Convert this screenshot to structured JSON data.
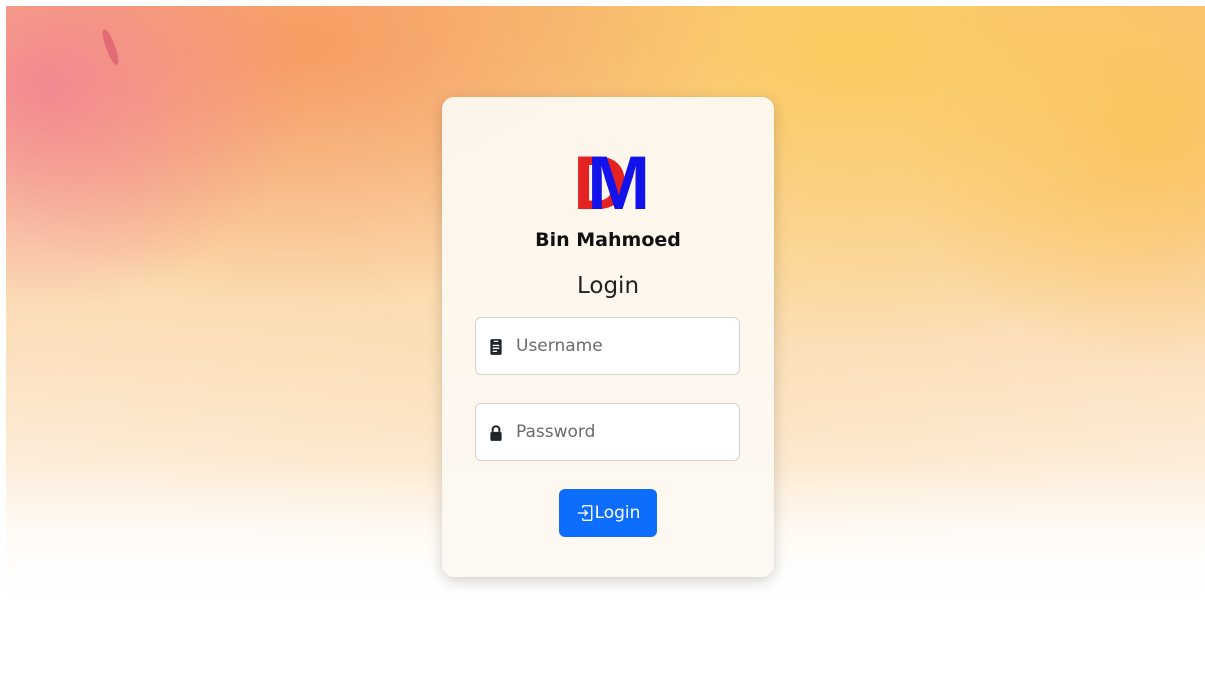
{
  "brand": {
    "logo_letters": [
      "D",
      "M"
    ],
    "name": "Bin Mahmoed"
  },
  "form": {
    "title": "Login",
    "username": {
      "placeholder": "Username",
      "value": "",
      "icon": "id-badge-icon"
    },
    "password": {
      "placeholder": "Password",
      "value": "",
      "icon": "lock-icon"
    },
    "submit": {
      "label": "Login",
      "icon": "box-arrow-in-right-icon"
    }
  },
  "colors": {
    "logo_d": "#e52222",
    "logo_m": "#1212ea",
    "button": "#0d6efd"
  }
}
